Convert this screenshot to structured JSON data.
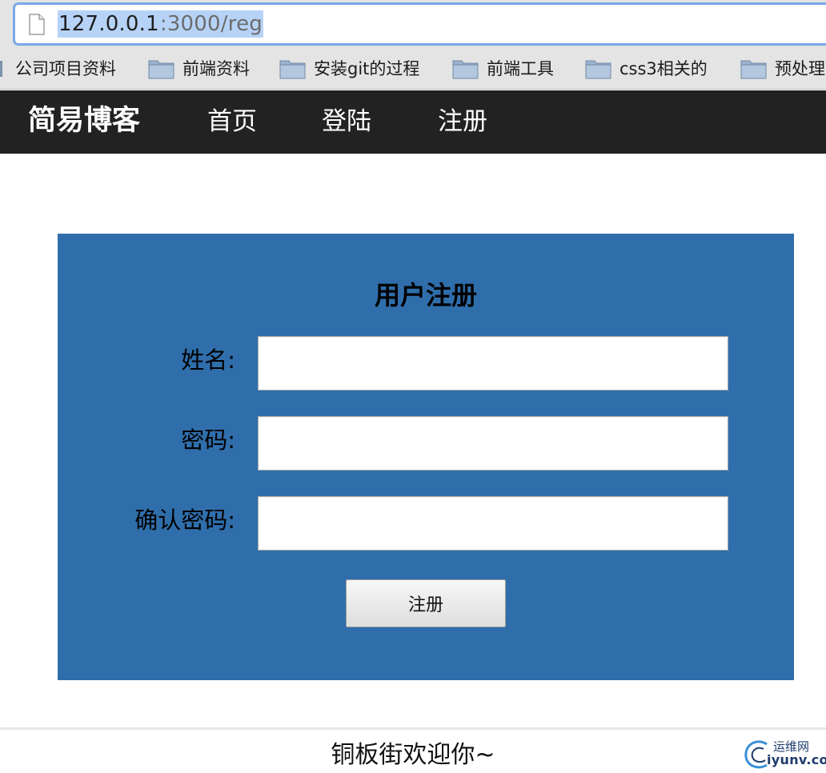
{
  "browser": {
    "url_host": "127.0.0.1",
    "url_path": ":3000/reg",
    "bookmarks": [
      {
        "label": "公司项目资料"
      },
      {
        "label": "前端资料"
      },
      {
        "label": "安装git的过程"
      },
      {
        "label": "前端工具"
      },
      {
        "label": "css3相关的"
      },
      {
        "label": "预处理"
      }
    ]
  },
  "nav": {
    "brand": "简易博客",
    "links": [
      {
        "label": "首页"
      },
      {
        "label": "登陆"
      },
      {
        "label": "注册"
      }
    ]
  },
  "form": {
    "title": "用户注册",
    "fields": [
      {
        "label": "姓名:",
        "value": "",
        "placeholder": ""
      },
      {
        "label": "密码:",
        "value": "",
        "placeholder": ""
      },
      {
        "label": "确认密码:",
        "value": "",
        "placeholder": ""
      }
    ],
    "submit_label": "注册"
  },
  "footer": {
    "text": "铜板街欢迎你~"
  },
  "watermark": {
    "cn": "运维网",
    "en": "iyunv.com"
  },
  "colors": {
    "panel_bg": "#2f6eab",
    "navbar_bg": "#222222",
    "url_highlight": "#b6d3f7"
  }
}
